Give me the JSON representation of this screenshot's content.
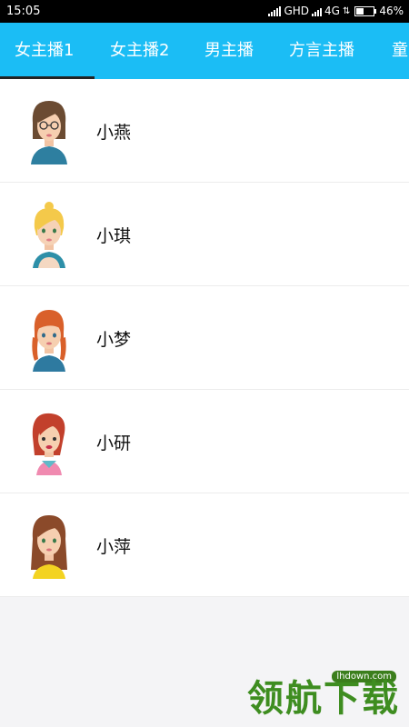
{
  "status_bar": {
    "time": "15:05",
    "network_label": "GHD",
    "network_type": "4G",
    "battery": "46%"
  },
  "tabs": [
    {
      "label": "女主播1",
      "active": true
    },
    {
      "label": "女主播2",
      "active": false
    },
    {
      "label": "男主播",
      "active": false
    },
    {
      "label": "方言主播",
      "active": false
    },
    {
      "label": "童",
      "active": false
    }
  ],
  "anchors": [
    {
      "name": "小燕",
      "avatar": "female-avatar-glasses-icon",
      "hair": "#6b4b32",
      "shirt": "#2e7fa0"
    },
    {
      "name": "小琪",
      "avatar": "female-avatar-blonde-icon",
      "hair": "#f4c94a",
      "shirt": "#2d8fa8"
    },
    {
      "name": "小梦",
      "avatar": "female-avatar-braids-icon",
      "hair": "#d9602a",
      "shirt": "#2e7aa0"
    },
    {
      "name": "小研",
      "avatar": "female-avatar-redhair-icon",
      "hair": "#c2402c",
      "shirt": "#f08ab0"
    },
    {
      "name": "小萍",
      "avatar": "female-avatar-brownhair-icon",
      "hair": "#8b4a2a",
      "shirt": "#f3d321"
    }
  ],
  "watermark": {
    "url": "lhdown.com",
    "text": "领航下载"
  }
}
